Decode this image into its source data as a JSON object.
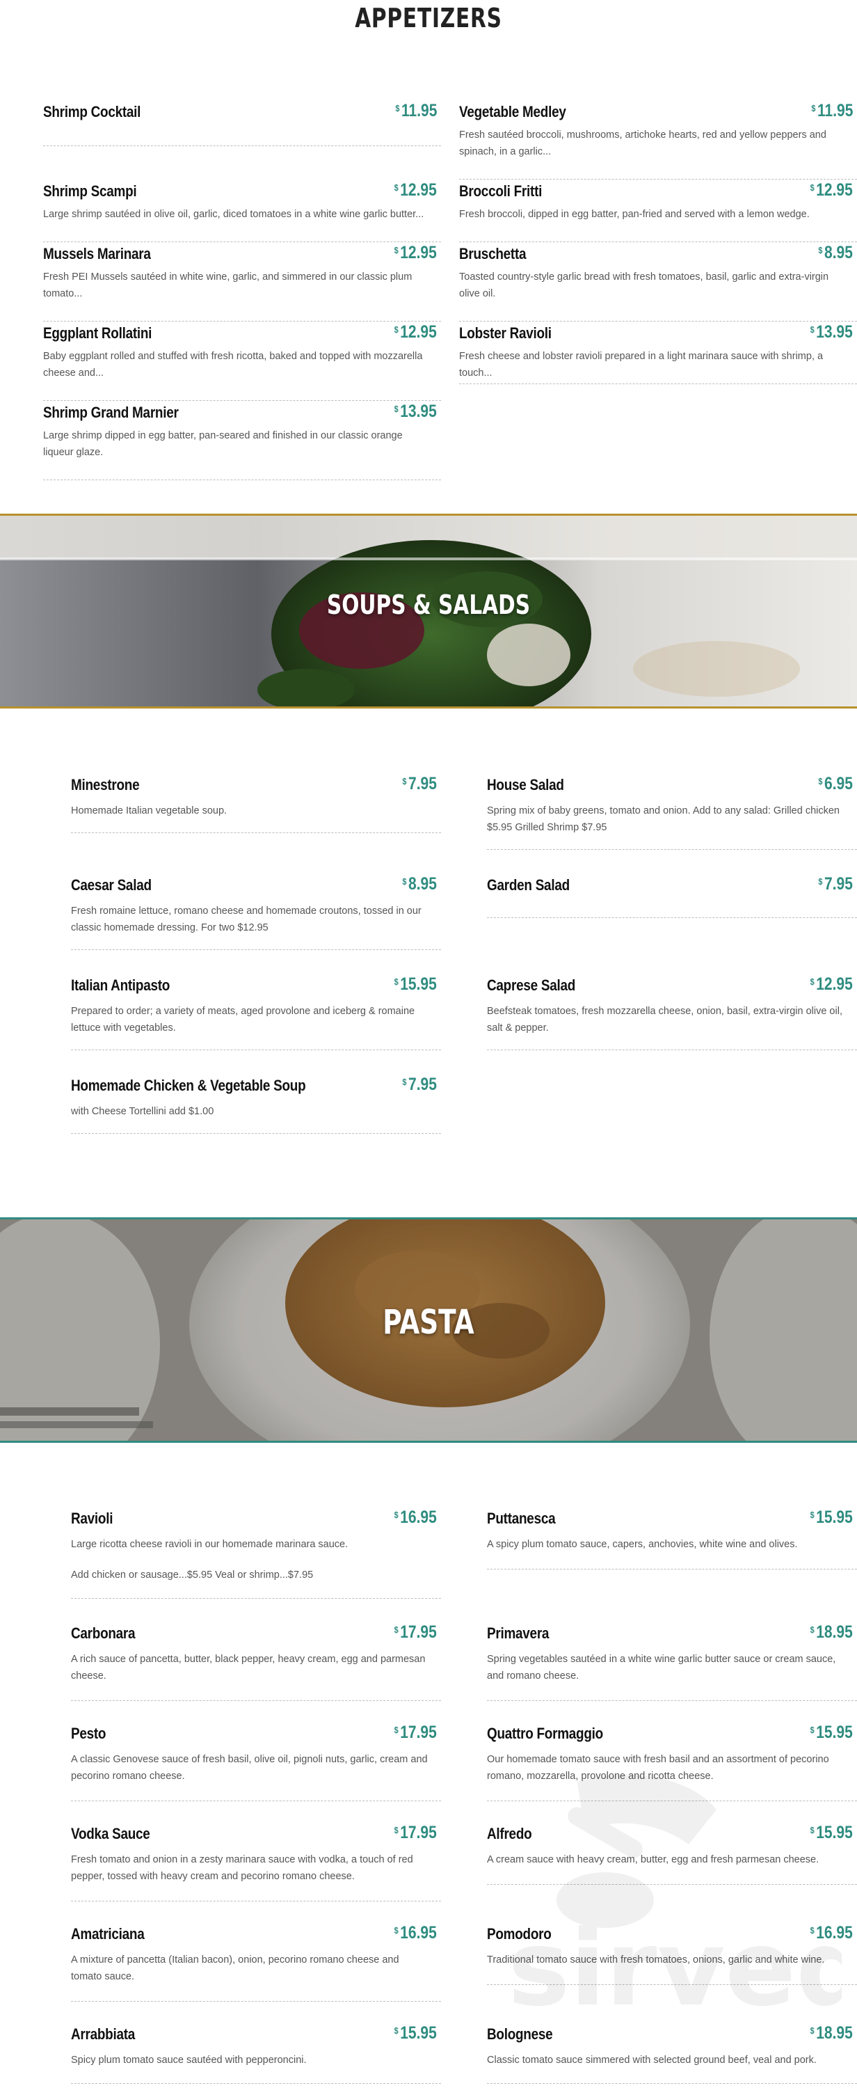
{
  "colors": {
    "price": "#2f8c80",
    "accent_gold": "#b8912e",
    "accent_teal": "#2f8c80"
  },
  "appetizers": {
    "title": "APPETIZERS",
    "left": [
      {
        "name": "Shrimp Cocktail",
        "price": "11.95",
        "desc": ""
      },
      {
        "name": "Shrimp Scampi",
        "price": "12.95",
        "desc": "Large shrimp sautéed in olive oil, garlic, diced tomatoes in a white wine garlic butter..."
      },
      {
        "name": "Mussels Marinara",
        "price": "12.95",
        "desc": "Fresh PEI Mussels sautéed in white wine, garlic, and simmered in our classic plum tomato..."
      },
      {
        "name": "Eggplant Rollatini",
        "price": "12.95",
        "desc": "Baby eggplant rolled and stuffed with fresh ricotta, baked and topped with mozzarella cheese and..."
      },
      {
        "name": "Shrimp Grand Marnier",
        "price": "13.95",
        "desc": "Large shrimp dipped in egg batter, pan-seared and finished in our classic orange liqueur glaze."
      }
    ],
    "right": [
      {
        "name": "Vegetable Medley",
        "price": "11.95",
        "desc": "Fresh sautéed broccoli, mushrooms, artichoke hearts, red and yellow peppers and spinach, in a garlic..."
      },
      {
        "name": "Broccoli Fritti",
        "price": "12.95",
        "desc": "Fresh broccoli, dipped in egg batter, pan-fried and served with a lemon wedge."
      },
      {
        "name": "Bruschetta",
        "price": "8.95",
        "desc": "Toasted country-style garlic bread with fresh tomatoes, basil, garlic and extra-virgin olive oil."
      },
      {
        "name": "Lobster Ravioli",
        "price": "13.95",
        "desc": "Fresh cheese and lobster ravioli prepared in a light marinara sauce with shrimp, a touch..."
      }
    ]
  },
  "soups_salads": {
    "title": "SOUPS & SALADS",
    "left": [
      {
        "name": "Minestrone",
        "price": "7.95",
        "desc": "Homemade Italian vegetable soup."
      },
      {
        "name": "Caesar Salad",
        "price": "8.95",
        "desc": "Fresh romaine lettuce, romano cheese and homemade croutons, tossed in our classic homemade dressing.  For two $12.95"
      },
      {
        "name": "Italian Antipasto",
        "price": "15.95",
        "desc": "Prepared to order; a variety of meats, aged provolone and iceberg & romaine lettuce with vegetables."
      },
      {
        "name": "Homemade Chicken & Vegetable Soup",
        "price": "7.95",
        "desc": "with Cheese Tortellini  add $1.00"
      }
    ],
    "right": [
      {
        "name": "House Salad",
        "price": "6.95",
        "desc": "Spring mix of baby greens, tomato and onion.  Add to any salad: Grilled chicken $5.95  Grilled Shrimp $7.95"
      },
      {
        "name": "Garden Salad",
        "price": "7.95",
        "desc": ""
      },
      {
        "name": "Caprese Salad",
        "price": "12.95",
        "desc": "Beefsteak tomatoes, fresh mozzarella cheese, onion, basil, extra-virgin olive oil, salt & pepper."
      }
    ]
  },
  "pasta": {
    "title": "PASTA",
    "left": [
      {
        "name": "Ravioli",
        "price": "16.95",
        "desc": "Large ricotta cheese ravioli in our homemade marinara sauce.",
        "desc2": "Add chicken or sausage...$5.95   Veal or shrimp...$7.95"
      },
      {
        "name": "Carbonara",
        "price": "17.95",
        "desc": "A rich sauce of pancetta, butter, black pepper, heavy cream, egg and parmesan cheese."
      },
      {
        "name": "Pesto",
        "price": "17.95",
        "desc": "A classic Genovese sauce of fresh basil, olive oil, pignoli nuts, garlic, cream and pecorino romano cheese."
      },
      {
        "name": "Vodka Sauce",
        "price": "17.95",
        "desc": "Fresh tomato and onion in a zesty marinara sauce with vodka, a touch of red pepper, tossed with heavy cream and pecorino romano cheese."
      },
      {
        "name": "Amatriciana",
        "price": "16.95",
        "desc": "A mixture of pancetta (Italian bacon), onion, pecorino romano cheese and tomato sauce."
      },
      {
        "name": "Arrabbiata",
        "price": "15.95",
        "desc": "Spicy plum tomato sauce sautéed with pepperoncini."
      }
    ],
    "right": [
      {
        "name": "Puttanesca",
        "price": "15.95",
        "desc": "A spicy plum tomato sauce, capers, anchovies, white wine and olives."
      },
      {
        "name": "Primavera",
        "price": "18.95",
        "desc": "Spring vegetables sautéed in a white wine garlic butter sauce or cream sauce, and romano cheese."
      },
      {
        "name": "Quattro Formaggio",
        "price": "15.95",
        "desc": "Our homemade tomato sauce with fresh basil and an assortment of pecorino romano, mozzarella, provolone and ricotta cheese."
      },
      {
        "name": "Alfredo",
        "price": "15.95",
        "desc": "A cream sauce with heavy cream, butter, egg and fresh parmesan cheese."
      },
      {
        "name": "Pomodoro",
        "price": "16.95",
        "desc": "Traditional tomato sauce with fresh tomatoes, onions, garlic and white wine."
      },
      {
        "name": "Bolognese",
        "price": "18.95",
        "desc": "Classic tomato sauce simmered with selected ground beef, veal and pork."
      }
    ]
  },
  "currency_symbol": "$",
  "watermark_text": "sirved"
}
